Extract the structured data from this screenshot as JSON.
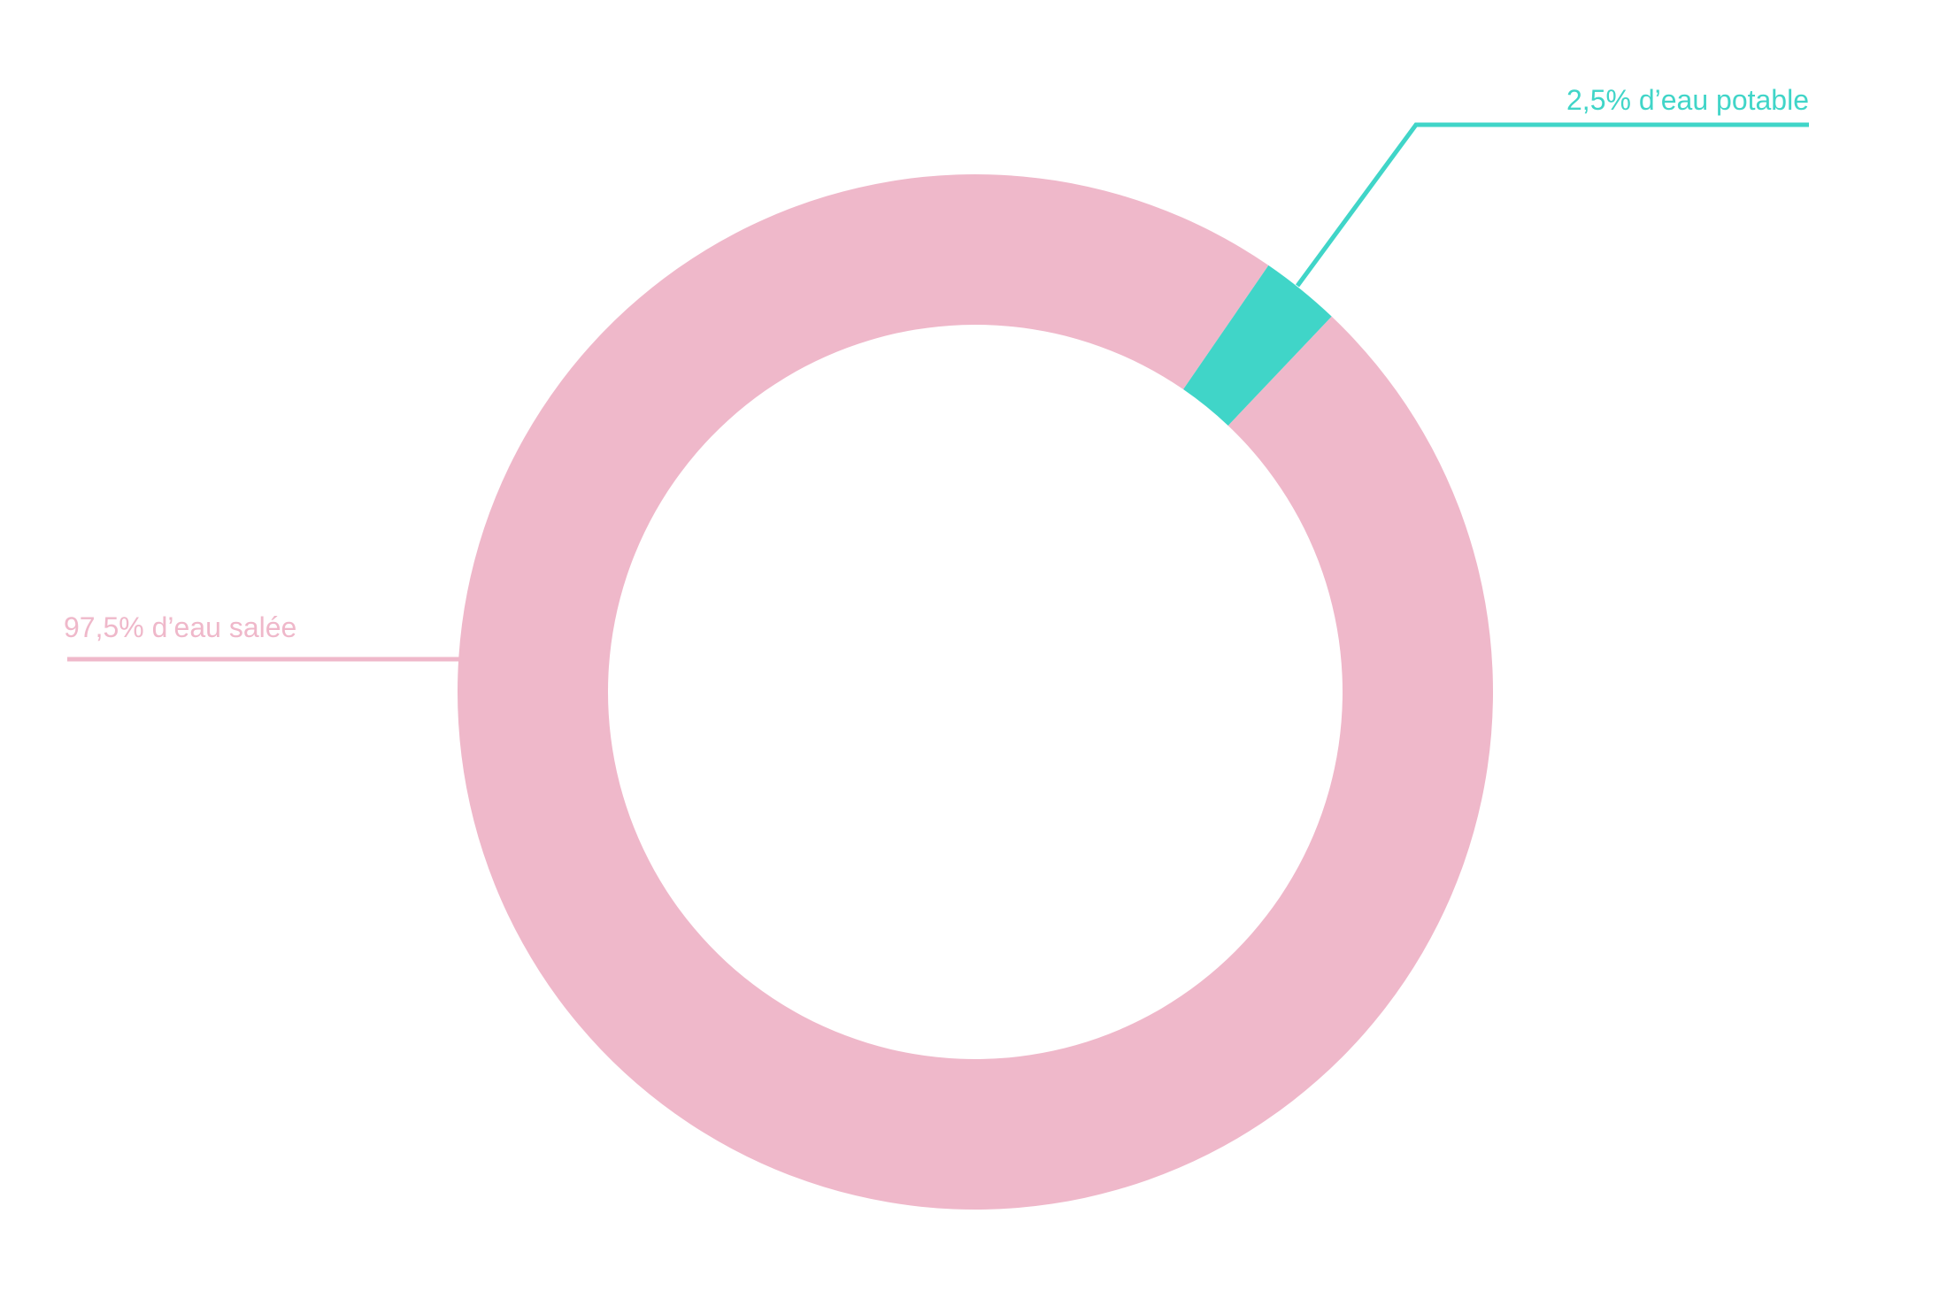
{
  "chart_data": {
    "type": "pie",
    "variant": "donut",
    "slices": [
      {
        "label": "97,5% d’eau salée",
        "value": 97.5,
        "color": "#EFB8CA"
      },
      {
        "label": "2,5% d’eau potable",
        "value": 2.5,
        "color": "#40D5C8"
      }
    ],
    "legend": "none"
  }
}
